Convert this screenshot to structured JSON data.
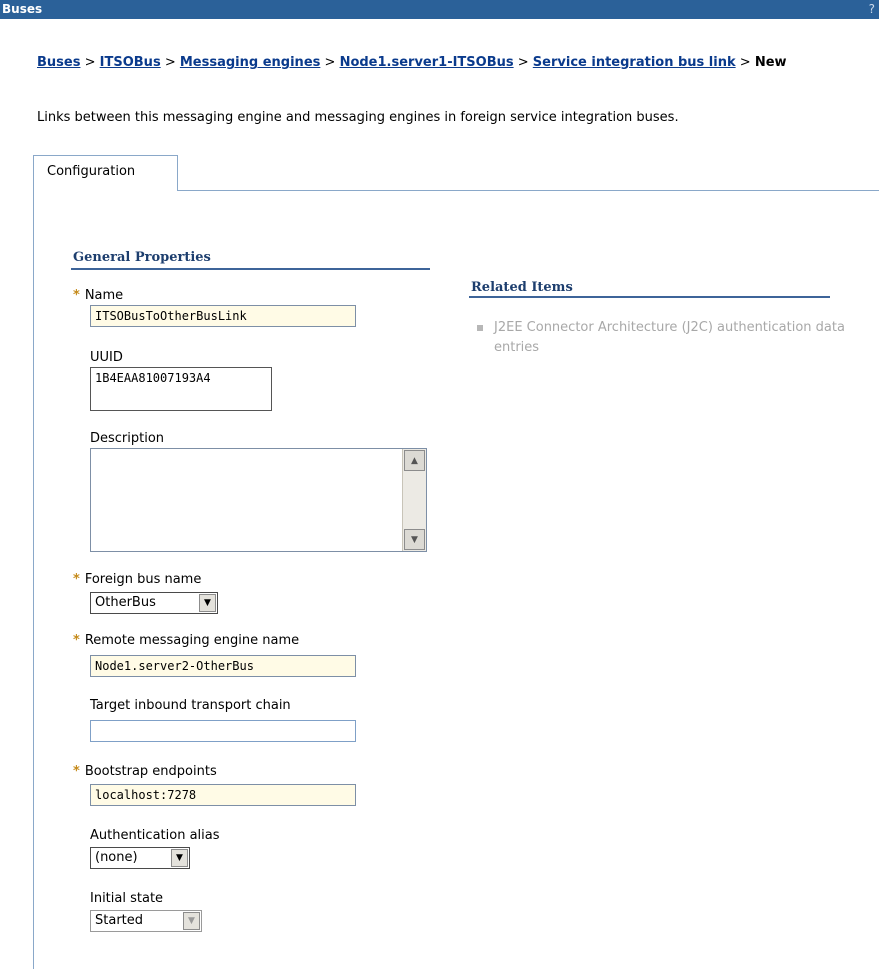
{
  "window": {
    "title": "Buses",
    "help_icon": "help-icon"
  },
  "breadcrumb": {
    "links": [
      "Buses",
      "ITSOBus",
      "Messaging engines",
      "Node1.server1-ITSOBus",
      "Service integration bus link"
    ],
    "current": "New",
    "separator": ">"
  },
  "intro": "Links between this messaging engine and messaging engines in foreign service integration buses.",
  "tabs": [
    {
      "label": "Configuration"
    }
  ],
  "general_properties": {
    "title": "General Properties",
    "name": {
      "label": "Name",
      "value": "ITSOBusToOtherBusLink",
      "required": true
    },
    "uuid": {
      "label": "UUID",
      "value": "1B4EAA81007193A4"
    },
    "description": {
      "label": "Description",
      "value": ""
    },
    "foreign_bus": {
      "label": "Foreign bus name",
      "value": "OtherBus",
      "required": true
    },
    "remote_engine": {
      "label": "Remote messaging engine name",
      "value": "Node1.server2-OtherBus",
      "required": true
    },
    "target_chain": {
      "label": "Target inbound transport chain",
      "value": ""
    },
    "bootstrap": {
      "label": "Bootstrap endpoints",
      "value": "localhost:7278",
      "required": true
    },
    "auth_alias": {
      "label": "Authentication alias",
      "value": "(none)"
    },
    "initial_state": {
      "label": "Initial state",
      "value": "Started"
    }
  },
  "related_items": {
    "title": "Related Items",
    "items": [
      "J2EE Connector Architecture (J2C) authentication data entries"
    ]
  },
  "colors": {
    "titlebar": "#2b6199",
    "link": "#0a3a8c",
    "section_rule": "#3d6499",
    "required_marker": "#c58a1a",
    "input_fill": "#fffbe6"
  }
}
